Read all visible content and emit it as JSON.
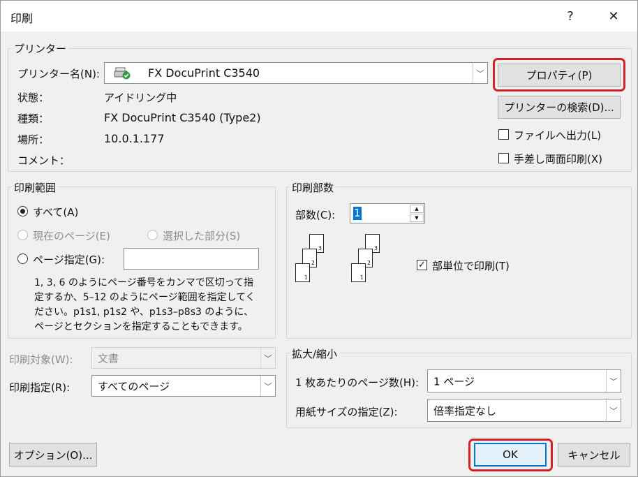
{
  "window": {
    "title": "印刷",
    "help_label": "?",
    "close_label": "✕"
  },
  "printer": {
    "group_label": "プリンター",
    "name_label": "プリンター名(N):",
    "name_value": "FX DocuPrint C3540",
    "status_label": "状態：",
    "status_value": "アイドリング中",
    "type_label": "種類：",
    "type_value": "FX DocuPrint C3540 (Type2)",
    "location_label": "場所：",
    "location_value": "10.0.1.177",
    "comment_label": "コメント：",
    "comment_value": "",
    "properties_button": "プロパティ(P)",
    "find_button": "プリンターの検索(D)...",
    "print_to_file": {
      "label": "ファイルへ出力(L)",
      "checked": false
    },
    "manual_duplex": {
      "label": "手差し両面印刷(X)",
      "checked": false
    }
  },
  "range": {
    "group_label": "印刷範囲",
    "all": {
      "label": "すべて(A)",
      "selected": true
    },
    "current": {
      "label": "現在のページ(E)",
      "enabled": false
    },
    "selection": {
      "label": "選択した部分(S)",
      "enabled": false
    },
    "pages": {
      "label": "ページ指定(G):",
      "value": ""
    },
    "help_lines": [
      "1, 3, 6 のようにページ番号をカンマで区切って指",
      "定するか、5–12 のようにページ範囲を指定してく",
      "ださい。p1s1, p1s2 や、p1s3–p8s3 のように、",
      "ページとセクションを指定することもできます。"
    ]
  },
  "copies": {
    "group_label": "印刷部数",
    "count_label": "部数(C):",
    "count_value": "1",
    "collate": {
      "label": "部単位で印刷(T)",
      "checked": true
    },
    "page_numbers": [
      "3",
      "2",
      "1"
    ]
  },
  "print_what": {
    "label": "印刷対象(W):",
    "value": "文書",
    "enabled": false
  },
  "print_spec": {
    "label": "印刷指定(R):",
    "value": "すべてのページ"
  },
  "zoom": {
    "group_label": "拡大/縮小",
    "pages_per_sheet_label": "1 枚あたりのページ数(H):",
    "pages_per_sheet_value": "1 ページ",
    "scale_label": "用紙サイズの指定(Z):",
    "scale_value": "倍率指定なし"
  },
  "footer": {
    "options_button": "オプション(O)...",
    "ok_button": "OK",
    "cancel_button": "キャンセル"
  },
  "colors": {
    "highlight": "#d2232a",
    "accent": "#0078d7"
  }
}
